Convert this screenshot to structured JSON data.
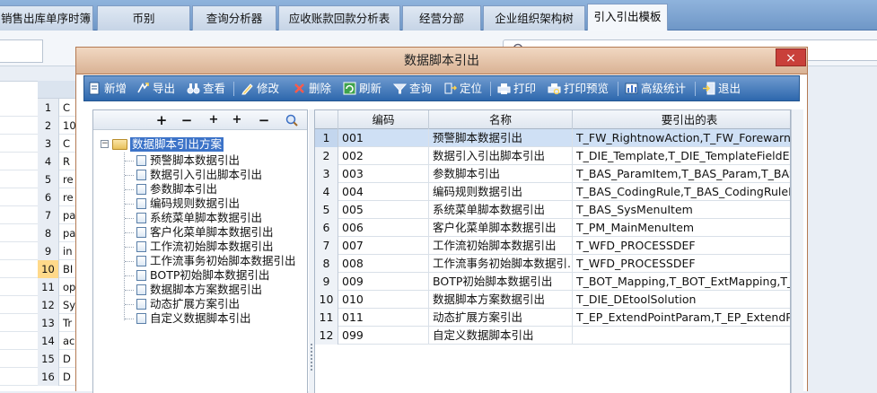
{
  "tabs": [
    {
      "label": "销售出库单序时簿",
      "active": false
    },
    {
      "label": "币别",
      "active": false
    },
    {
      "label": "查询分析器",
      "active": false
    },
    {
      "label": "应收账款回款分析表",
      "active": false
    },
    {
      "label": "经营分部",
      "active": false
    },
    {
      "label": "企业组织架构树",
      "active": false
    },
    {
      "label": "引入引出模板",
      "active": true
    }
  ],
  "background_grid": {
    "rows": [
      {
        "num": "1",
        "value": "C"
      },
      {
        "num": "2",
        "value": "10"
      },
      {
        "num": "3",
        "value": "C"
      },
      {
        "num": "4",
        "value": "R"
      },
      {
        "num": "5",
        "value": "re"
      },
      {
        "num": "6",
        "value": "re"
      },
      {
        "num": "7",
        "value": "pa"
      },
      {
        "num": "8",
        "value": "pa"
      },
      {
        "num": "9",
        "value": "in"
      },
      {
        "num": "10",
        "value": "BI"
      },
      {
        "num": "11",
        "value": "op"
      },
      {
        "num": "12",
        "value": "Sy"
      },
      {
        "num": "13",
        "value": "Tr"
      },
      {
        "num": "14",
        "value": "ac"
      },
      {
        "num": "15",
        "value": "D"
      },
      {
        "num": "16",
        "value": "D"
      }
    ],
    "selected_row": "10"
  },
  "dialog": {
    "title": "数据脚本引出",
    "close_label": "×",
    "toolbar": {
      "new": "新增",
      "export": "导出",
      "view": "查看",
      "edit": "修改",
      "delete": "删除",
      "refresh": "刷新",
      "query": "查询",
      "locate": "定位",
      "print": "打印",
      "print_preview": "打印预览",
      "advanced_stats": "高级统计",
      "exit": "退出"
    },
    "tree_tools": [
      "+",
      "−",
      "+",
      "+",
      "−",
      "search"
    ],
    "tree": {
      "root": "数据脚本引出方案",
      "root_toggle": "−",
      "items": [
        "预警脚本数据引出",
        "数据引入引出脚本引出",
        "参数脚本引出",
        "编码规则数据引出",
        "系统菜单脚本数据引出",
        "客户化菜单脚本数据引出",
        "工作流初始脚本数据引出",
        "工作流事务初始脚本数据引出",
        "BOTP初始脚本数据引出",
        "数据脚本方案数据引出",
        "动态扩展方案引出",
        "自定义数据脚本引出"
      ]
    },
    "grid": {
      "columns": [
        "编码",
        "名称",
        "要引出的表"
      ],
      "rows": [
        {
          "num": "1",
          "code": "001",
          "name": "预警脚本数据引出",
          "tables": "T_FW_RightnowAction,T_FW_ForewarnMsg"
        },
        {
          "num": "2",
          "code": "002",
          "name": "数据引入引出脚本引出",
          "tables": "T_DIE_Template,T_DIE_TemplateFieldEntry"
        },
        {
          "num": "3",
          "code": "003",
          "name": "参数脚本引出",
          "tables": "T_BAS_ParamItem,T_BAS_Param,T_BAS_F"
        },
        {
          "num": "4",
          "code": "004",
          "name": "编码规则数据引出",
          "tables": "T_BAS_CodingRule,T_BAS_CodingRuleEnt"
        },
        {
          "num": "5",
          "code": "005",
          "name": "系统菜单脚本数据引出",
          "tables": "T_BAS_SysMenuItem"
        },
        {
          "num": "6",
          "code": "006",
          "name": "客户化菜单脚本数据引出",
          "tables": "T_PM_MainMenuItem"
        },
        {
          "num": "7",
          "code": "007",
          "name": "工作流初始脚本数据引出",
          "tables": "T_WFD_PROCESSDEF"
        },
        {
          "num": "8",
          "code": "008",
          "name": "工作流事务初始脚本数据引...",
          "tables": "T_WFD_PROCESSDEF"
        },
        {
          "num": "9",
          "code": "009",
          "name": "BOTP初始脚本数据引出",
          "tables": "T_BOT_Mapping,T_BOT_ExtMapping,T_BOT"
        },
        {
          "num": "10",
          "code": "010",
          "name": "数据脚本方案数据引出",
          "tables": "T_DIE_DEtoolSolution"
        },
        {
          "num": "11",
          "code": "011",
          "name": "动态扩展方案引出",
          "tables": "T_EP_ExtendPointParam,T_EP_ExtendPoin"
        },
        {
          "num": "12",
          "code": "099",
          "name": "自定义数据脚本引出",
          "tables": ""
        }
      ],
      "selected_row": "1"
    }
  }
}
